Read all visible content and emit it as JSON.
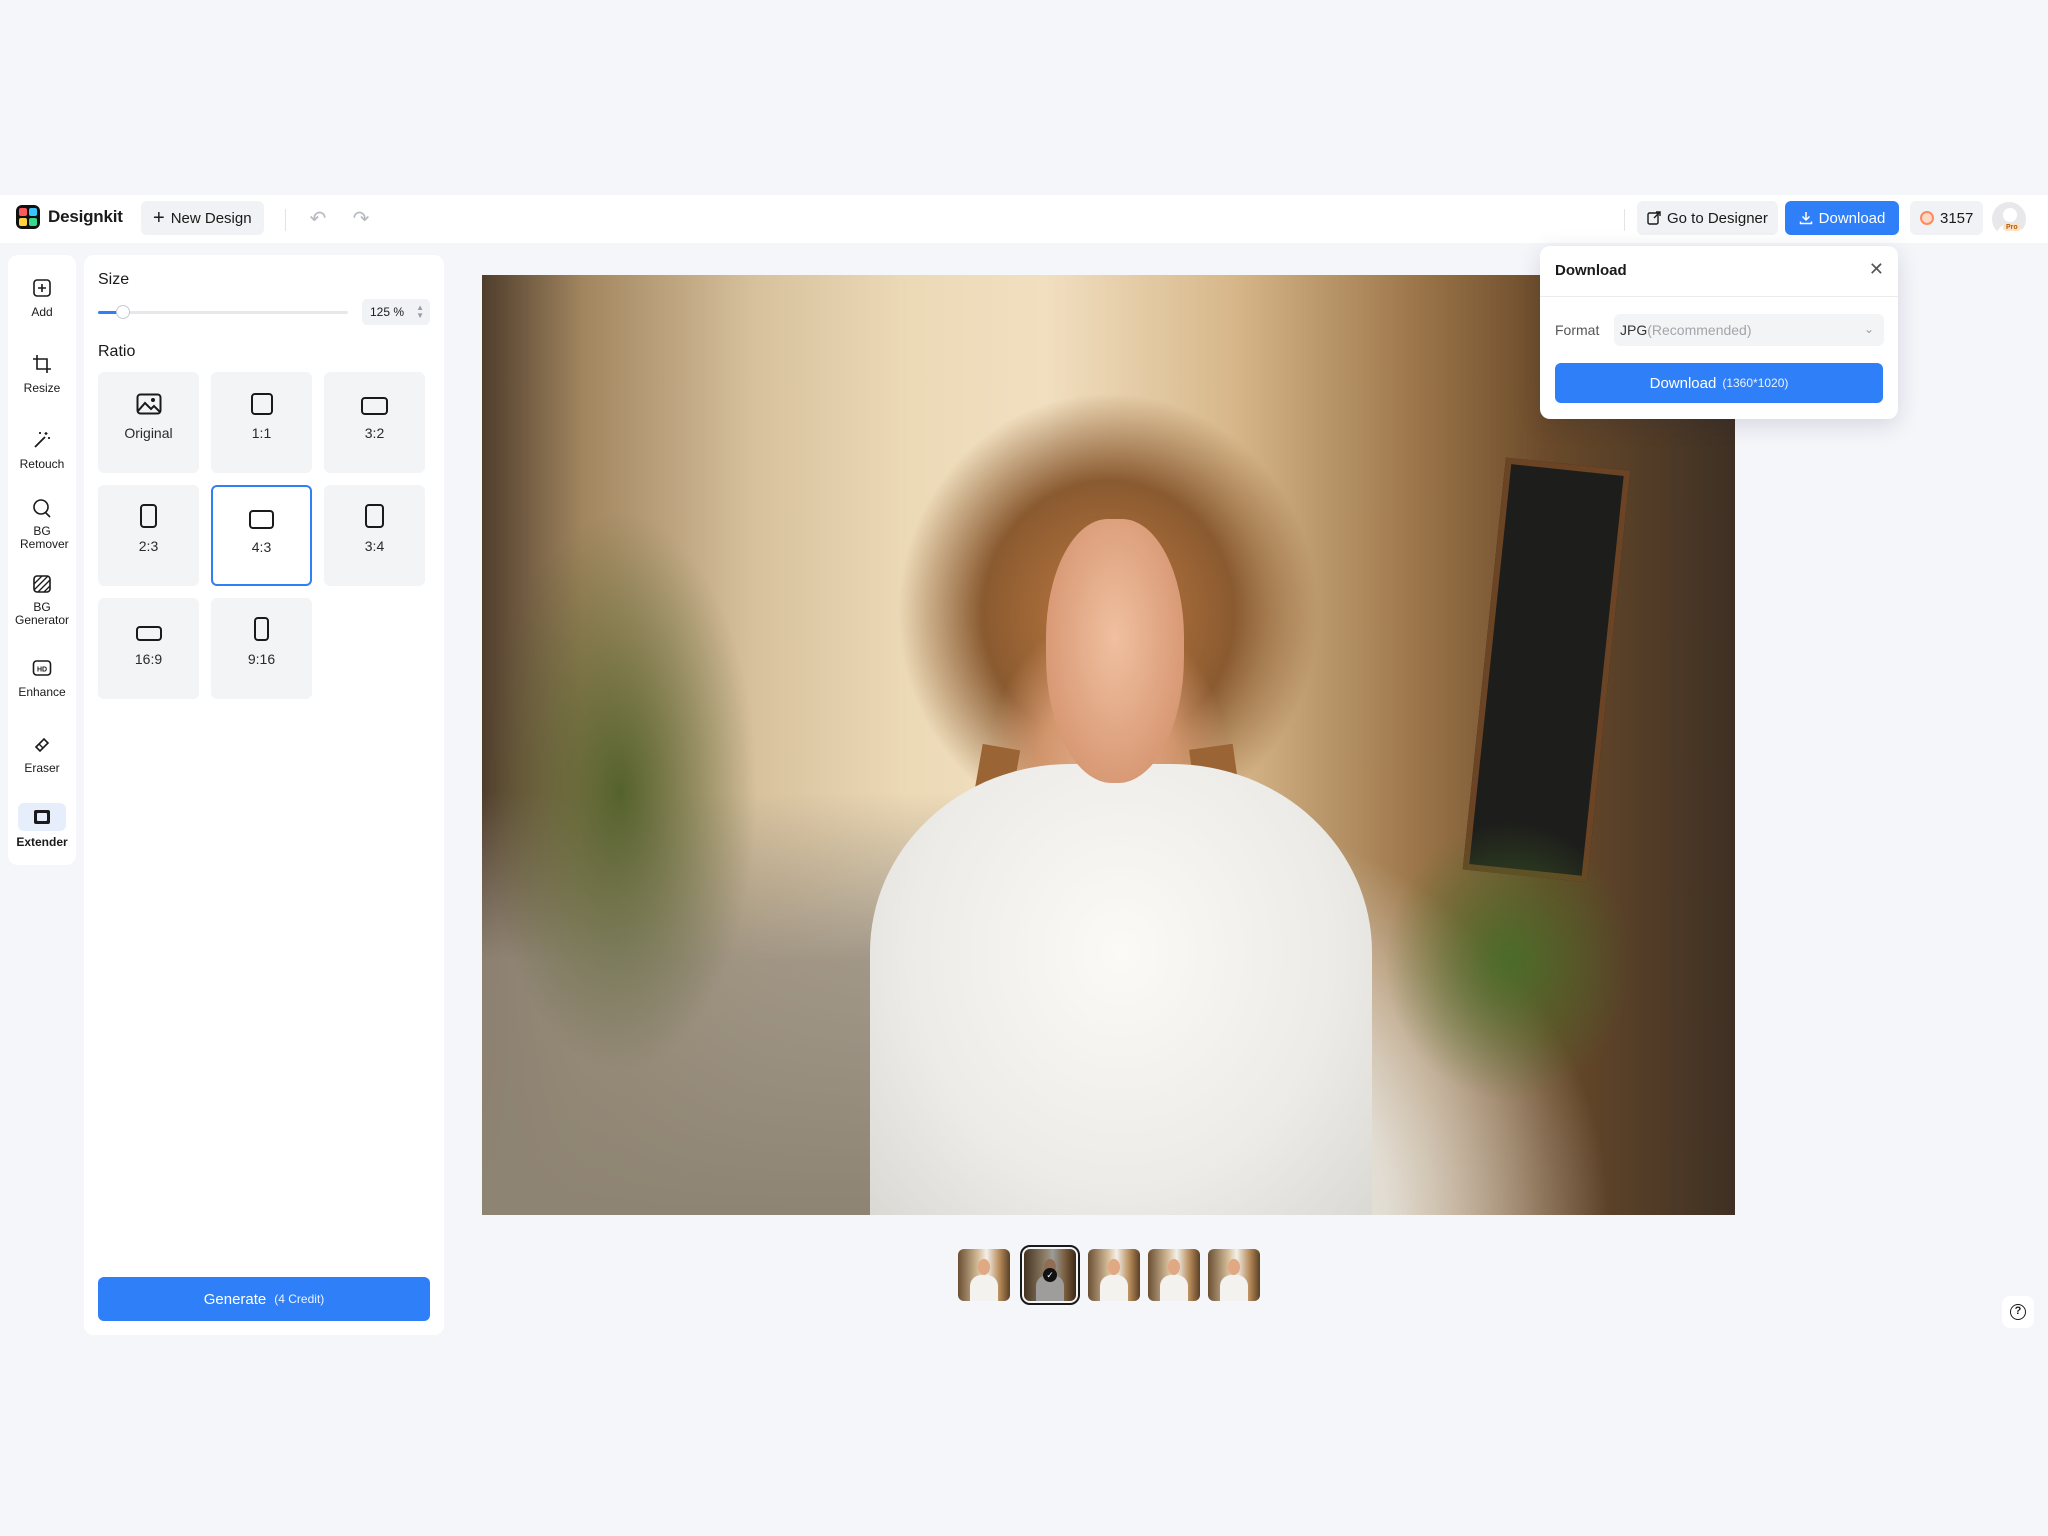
{
  "app": {
    "name": "Designkit"
  },
  "toolbar": {
    "new_design_label": "New Design",
    "go_to_designer_label": "Go to Designer",
    "download_label": "Download",
    "credits": "3157",
    "pro_badge": "Pro"
  },
  "tools": [
    {
      "label": "Add",
      "icon": "add-icon"
    },
    {
      "label": "Resize",
      "icon": "crop-icon"
    },
    {
      "label": "Retouch",
      "icon": "magic-wand-icon"
    },
    {
      "label": "BG Remover",
      "icon": "bg-remover-icon"
    },
    {
      "label": "BG Generator",
      "icon": "bg-generator-icon"
    },
    {
      "label": "Enhance",
      "icon": "hd-icon"
    },
    {
      "label": "Eraser",
      "icon": "eraser-icon"
    },
    {
      "label": "Extender",
      "icon": "extender-icon",
      "active": true
    }
  ],
  "panel": {
    "size_title": "Size",
    "size_value": "125 %",
    "size_fraction": 0.1,
    "ratio_title": "Ratio",
    "ratios": [
      {
        "label": "Original"
      },
      {
        "label": "1:1"
      },
      {
        "label": "3:2"
      },
      {
        "label": "2:3"
      },
      {
        "label": "4:3",
        "selected": true
      },
      {
        "label": "3:4"
      },
      {
        "label": "16:9"
      },
      {
        "label": "9:16"
      }
    ],
    "generate_label": "Generate",
    "generate_credit": "(4 Credit)"
  },
  "download_popover": {
    "title": "Download",
    "format_label": "Format",
    "format_value": "JPG",
    "format_hint": "(Recommended)",
    "button_label": "Download",
    "button_dims": "(1360*1020)"
  },
  "thumbnails": {
    "count": 5,
    "selected_index": 1
  },
  "colors": {
    "accent": "#2f7ff8",
    "background": "#f5f6fa",
    "selected_border": "#2f7ff8"
  }
}
